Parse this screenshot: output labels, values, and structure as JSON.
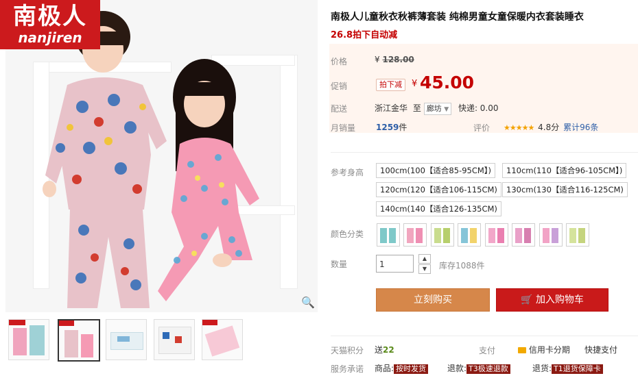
{
  "brand": {
    "cn": "南极人",
    "en": "nanjiren"
  },
  "product": {
    "title": "南极人儿童秋衣秋裤薄套装 纯棉男童女童保暖内衣套装睡衣",
    "promo": "26.8拍下自动减"
  },
  "price": {
    "label": "价格",
    "currency": "¥",
    "original": "128.00",
    "promo_label": "促销",
    "promo_tag": "拍下减",
    "promo_price": "45.00",
    "ship_label": "配送",
    "ship_from": "浙江金华",
    "ship_to_word": "至",
    "ship_to": "廊坊",
    "express": "快递: 0.00",
    "sales_label": "月销量",
    "sales_count": "1259",
    "sales_unit": "件",
    "rating_label": "评价",
    "stars": "★★★★★",
    "score": "4.8分",
    "reviews": "累计96条"
  },
  "size": {
    "label": "参考身高",
    "options": [
      "100cm(100【适合85-95CM】)",
      "110cm(110【适合96-105CM】)",
      "120cm(120【适合106-115CM)",
      "130cm(130【适合116-125CM)",
      "140cm(140【适合126-135CM)"
    ]
  },
  "color": {
    "label": "颜色分类",
    "swatches": [
      {
        "top": "#7fc9c9",
        "bottom": "#7fc9c9"
      },
      {
        "top": "#f1a6bf",
        "bottom": "#ef8fb3"
      },
      {
        "top": "#c9dc8e",
        "bottom": "#b7cf6c"
      },
      {
        "top": "#86c5d8",
        "bottom": "#f2d36b"
      },
      {
        "top": "#f2a7c9",
        "bottom": "#ea7fb0"
      },
      {
        "top": "#e9a0c8",
        "bottom": "#d77fb0"
      },
      {
        "top": "#f2a3c6",
        "bottom": "#c9a0d8"
      },
      {
        "top": "#d5e39c",
        "bottom": "#c5d47e"
      }
    ]
  },
  "quantity": {
    "label": "数量",
    "value": "1",
    "up": "▲",
    "down": "▼",
    "stock": "库存1088件"
  },
  "actions": {
    "buy": "立刻购买",
    "cart": "加入购物车",
    "cart_icon": "🛒"
  },
  "footer": {
    "points_label": "天猫积分",
    "points_prefix": "送",
    "points_value": "22",
    "pay_label": "支付",
    "card_text": "信用卡分期",
    "quick_pay": "快捷支付",
    "service_label": "服务承诺",
    "s1_prefix": "商品:",
    "s1_badge": "按时发货",
    "s2_prefix": "退款:",
    "s2_badge": "T3极速退款",
    "s3_prefix": "退货:",
    "s3_badge": "T1退货保障卡"
  },
  "colors": {
    "accent_red": "#c40000",
    "buy_orange": "#d6874a",
    "cart_red": "#c91a1a",
    "brand_red": "#cc1a1d"
  },
  "zoom_icon": "🔍"
}
